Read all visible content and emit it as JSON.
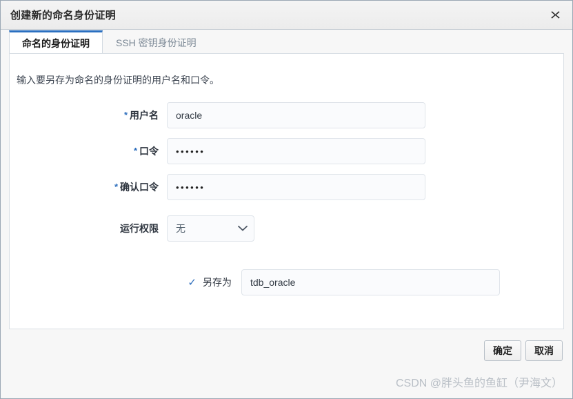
{
  "dialog": {
    "title": "创建新的命名身份证明",
    "close_icon": "close-icon"
  },
  "tabs": [
    {
      "label": "命名的身份证明",
      "active": true
    },
    {
      "label": "SSH 密钥身份证明",
      "active": false
    }
  ],
  "content": {
    "intro": "输入要另存为命名的身份证明的用户名和口令。",
    "fields": [
      {
        "required_marker": "*",
        "label": "用户名",
        "value": "oracle",
        "placeholder": ""
      },
      {
        "required_marker": "*",
        "label": "口令",
        "value": "••••••",
        "placeholder": ""
      },
      {
        "required_marker": "*",
        "label": "确认口令",
        "value": "••••••",
        "placeholder": ""
      }
    ],
    "run_privilege": {
      "label": "运行权限",
      "selected": "无",
      "options": [
        "无"
      ]
    },
    "save_as": {
      "check_glyph": "✓",
      "label": "另存为",
      "value": "tdb_oracle",
      "placeholder": "",
      "checked": true
    }
  },
  "footer": {
    "ok_label": "确定",
    "cancel_label": "取消"
  },
  "watermark": {
    "text": "CSDN @胖头鱼的鱼缸（尹海文）"
  },
  "colors": {
    "accent": "#2a6fc0",
    "required_asterisk": "#2f6fbd",
    "check": "#2f6fbd",
    "titlebar_border": "#bfc7cf",
    "panel_border": "#d9dfe5",
    "field_bg": "#fafbfd",
    "field_border": "#dfe4ea",
    "watermark": "#b9bfc6"
  }
}
